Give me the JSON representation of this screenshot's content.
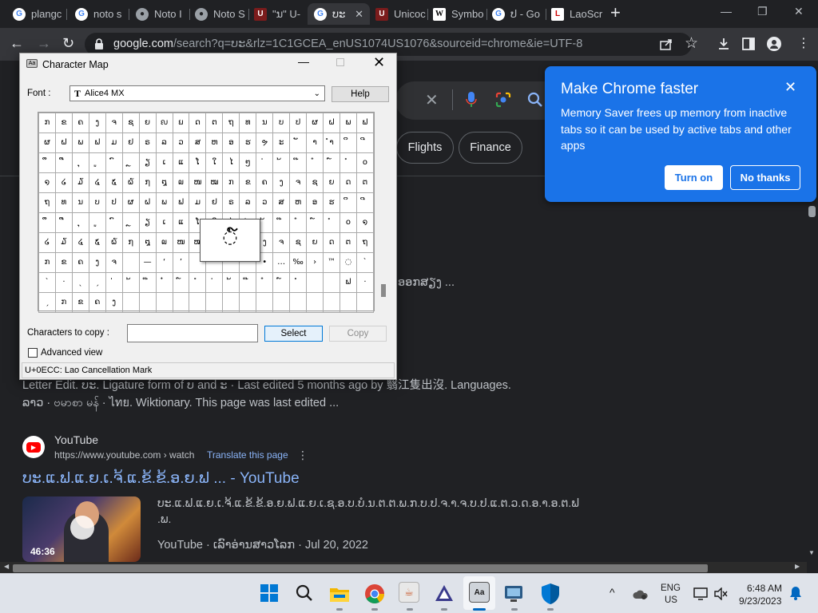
{
  "tabs": [
    {
      "label": "plangc",
      "icon": "google-icon",
      "close": ""
    },
    {
      "label": "noto s",
      "icon": "google-icon",
      "close": ""
    },
    {
      "label": "Noto I",
      "icon": "globe-icon",
      "close": ""
    },
    {
      "label": "Noto S",
      "icon": "globe-icon",
      "close": ""
    },
    {
      "label": "\"ນ\" U-",
      "icon": "unicode-icon",
      "close": ""
    },
    {
      "label": "ບະ",
      "icon": "google-icon",
      "close": "✕"
    },
    {
      "label": "Unicoc",
      "icon": "unicode-icon",
      "close": ""
    },
    {
      "label": "Symbo",
      "icon": "wikipedia-icon",
      "close": ""
    },
    {
      "label": "ປ - Go",
      "icon": "google-icon",
      "close": ""
    },
    {
      "label": "LaoScr",
      "icon": "laoscript-icon",
      "close": ""
    }
  ],
  "new_tab": "+",
  "window_controls": {
    "minimize": "—",
    "maximize": "❐",
    "close": "✕"
  },
  "toolbar": {
    "back": "←",
    "forward": "→",
    "reload": "↻",
    "url_domain": "google.com",
    "url_path": "/search?q=ບະ&rlz=1C1GCEA_enUS1074US1076&sourceid=chrome&ie=UTF-8"
  },
  "search": {
    "clear": "✕",
    "chips": [
      "Flights",
      "Finance"
    ]
  },
  "results": {
    "snippet_lao_tail": "ອອກສຽງ ...",
    "result1_line1": "Letter Edit. ບະ. Ligature form of ບ and ະ · Last edited 5 months ago by 翳江隻出沒. Languages.",
    "result1_line2": "ລາວ · ဗမာစာ မန် · ไทย. Wiktionary. This page was last edited ...",
    "yt_site": "YouTube",
    "yt_url": "https://www.youtube.com › watch",
    "yt_translate": "Translate this page",
    "yt_more": "⋮",
    "yt_title": "ບະ.ແ.ຟ.ແ.ຍ.ເ.ຈ້.ແ.ຂ້.ຂ້.ອ.ຍ.ຟ ... - YouTube",
    "yt_desc_line1": "ບະ.ແ.ຟ.ແ.ຍ.ເ.ຈ້.ແ.ຂ້.ຂ້.ອ.ຍ.ຟ.ແ.ຍ.ເ.ຊ.ອ.ບ.ບໍ.ນ.ຕ.ຕ.ພ.ກ.ບ.ປ.ຈ.າ.ຈ.ບ.ປ.ແ.ຕ.ວ.ດ.ອ.າ.ອ.ຕ.ຟ",
    "yt_desc_line2": ".ພ.",
    "yt_meta": "YouTube · ເລົາອ່ານສາວໂລກ · Jul 20, 2022",
    "video_duration": "46:36"
  },
  "promo": {
    "title": "Make Chrome faster",
    "body": "Memory Saver frees up memory from inactive tabs so it can be used by active tabs and other apps",
    "close": "✕",
    "turn_on": "Turn on",
    "no_thanks": "No thanks"
  },
  "charmap": {
    "title": "Character Map",
    "min": "—",
    "close": "✕",
    "font_label": "Font :",
    "font_value": "Alice4 MX",
    "font_icon": "T",
    "dropdown": "⌵",
    "help": "Help",
    "zoom_char": "◌໌",
    "grid_rows": [
      [
        "ກ",
        "ຂ",
        "ຄ",
        "ງ",
        "ຈ",
        "ຊ",
        "ຍ",
        "ຎ",
        "ຏ",
        "ດ",
        "ຕ",
        "ຖ",
        "ທ",
        "ນ",
        "ບ",
        "ປ",
        "ຜ",
        "ຝ",
        "ພ",
        "ຟ"
      ],
      [
        "ຜ",
        "ຝ",
        "ພ",
        "ຟ",
        "ມ",
        "ຢ",
        "ຣ",
        "ລ",
        "ວ",
        "ສ",
        "ຫ",
        "ອ",
        "ຮ",
        "ຯ",
        "ະ",
        "ັ",
        "າ",
        "ຳ",
        "ິ",
        "ີ"
      ],
      [
        "ຶ",
        "ື",
        "ຸ",
        "ູ",
        "ົ",
        "ຼ",
        "ຽ",
        "ເ",
        "ແ",
        "ໂ",
        "ໃ",
        "ໄ",
        "ໆ",
        "່",
        "້",
        "໊",
        "໋",
        "໌",
        "ໍ",
        "໐"
      ],
      [
        "໑",
        "໒",
        "໓",
        "໔",
        "໕",
        "໖",
        "໗",
        "໘",
        "໙",
        "ໜ",
        "ໝ",
        "ກ",
        "ຂ",
        "ຄ",
        "ງ",
        "ຈ",
        "ຊ",
        "ຍ",
        "ດ",
        "ຕ"
      ],
      [
        "ຖ",
        "ທ",
        "ນ",
        "ບ",
        "ປ",
        "ຜ",
        "ຝ",
        "ພ",
        "ຟ",
        "ມ",
        "ຢ",
        "ຣ",
        "ລ",
        "ວ",
        "ສ",
        "ຫ",
        "ອ",
        "ຮ",
        "ິ",
        "ີ"
      ],
      [
        "ຶ",
        "ື",
        "ຸ",
        "ູ",
        "ົ",
        "ຼ",
        "ຽ",
        "ເ",
        "ແ",
        "ໂ",
        "ໃ",
        "ໄ",
        "່",
        "້",
        "໊",
        "໋",
        "໌",
        "ໍ",
        "໐",
        "໑"
      ],
      [
        "໒",
        "໓",
        "໔",
        "໕",
        "໖",
        "໗",
        "໘",
        "໙",
        "ໜ",
        "ໝ",
        "ກ",
        "ຂ",
        "ຄ",
        "ງ",
        "ຈ",
        "ຊ",
        "ຍ",
        "ດ",
        "ຕ",
        "ຖ"
      ],
      [
        "ກ",
        "ຂ",
        "ຄ",
        "ງ",
        "ຈ",
        " ",
        "—",
        "‘",
        "’",
        " ",
        " ",
        " ",
        " ",
        "•",
        "…",
        "‰",
        "›",
        "™",
        "◌",
        "ˋ"
      ],
      [
        "ˋ",
        "·",
        "ˎ",
        "ˏ",
        "່",
        "້",
        "໊",
        "໋",
        "໌",
        "ໍ",
        "່",
        "້",
        "໊",
        "໋",
        "໌",
        "ໍ",
        " ",
        " ",
        "ຟ",
        "·"
      ],
      [
        "ˏ",
        "ກ",
        "ຂ",
        "ຄ",
        "ງ",
        " ",
        " ",
        " ",
        " ",
        " ",
        " ",
        " ",
        " ",
        " ",
        " ",
        " ",
        " ",
        " ",
        " ",
        " "
      ]
    ],
    "copy_label": "Characters to copy :",
    "copy_value": "",
    "select": "Select",
    "copy": "Copy",
    "advanced": "Advanced view",
    "status": "U+0ECC: Lao Cancellation Mark"
  },
  "taskbar": {
    "apps": [
      "windows-start-icon",
      "search-icon",
      "file-explorer-icon",
      "chrome-icon",
      "java-icon",
      "inkscape-icon",
      "character-map-icon",
      "screen-capture-icon",
      "defender-icon"
    ],
    "tray_chevron": "^",
    "lang_top": "ENG",
    "lang_bottom": "US",
    "time": "6:48 AM",
    "date": "9/23/2023"
  }
}
